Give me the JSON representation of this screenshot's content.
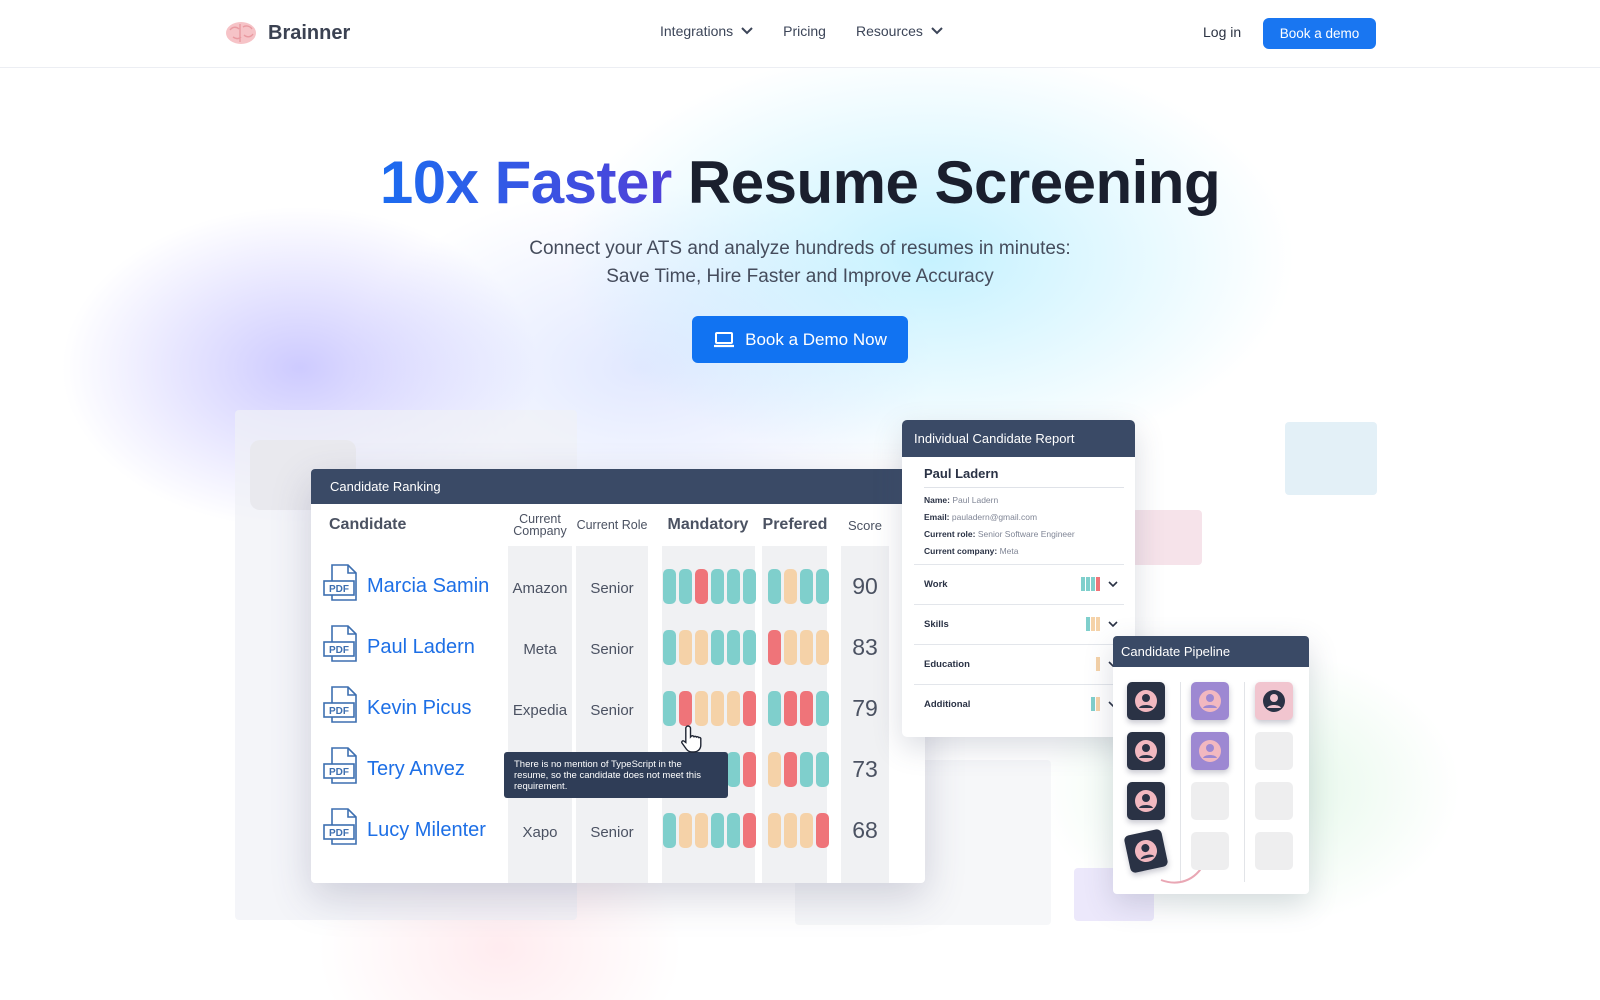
{
  "nav": {
    "brand": "Brainner",
    "links": [
      {
        "label": "Integrations",
        "dropdown": true
      },
      {
        "label": "Pricing",
        "dropdown": false
      },
      {
        "label": "Resources",
        "dropdown": true
      }
    ],
    "login": "Log in",
    "demo_button": "Book a demo"
  },
  "hero": {
    "title_accent": "10x Faster",
    "title_rest": "Resume Screening",
    "subtitle_line1": "Connect your ATS and analyze hundreds of resumes in minutes:",
    "subtitle_line2": "Save Time, Hire Faster and Improve Accuracy",
    "cta": "Book a Demo Now"
  },
  "ranking": {
    "title": "Candidate Ranking",
    "headers": {
      "candidate": "Candidate",
      "company": "Current Company",
      "role": "Current Role",
      "mandatory": "Mandatory",
      "preferred": "Prefered",
      "score": "Score"
    },
    "file_icon_label": "PDF",
    "rows": [
      {
        "name": "Marcia Samin",
        "company": "Amazon",
        "role": "Senior",
        "score": "90",
        "mandatory": [
          "teal",
          "teal",
          "red",
          "teal",
          "teal",
          "teal"
        ],
        "preferred": [
          "teal",
          "peach",
          "teal",
          "teal"
        ]
      },
      {
        "name": "Paul Ladern",
        "company": "Meta",
        "role": "Senior",
        "score": "83",
        "mandatory": [
          "teal",
          "peach",
          "peach",
          "teal",
          "teal",
          "teal"
        ],
        "preferred": [
          "red",
          "peach",
          "peach",
          "peach"
        ]
      },
      {
        "name": "Kevin Picus",
        "company": "Expedia",
        "role": "Senior",
        "score": "79",
        "mandatory": [
          "teal",
          "red",
          "peach",
          "peach",
          "peach",
          "red"
        ],
        "preferred": [
          "teal",
          "red",
          "red",
          "teal"
        ]
      },
      {
        "name": "Tery Anvez",
        "company": "",
        "role": "",
        "score": "73",
        "mandatory": [
          "teal",
          "teal",
          "peach",
          "teal",
          "teal",
          "red"
        ],
        "preferred": [
          "peach",
          "red",
          "teal",
          "teal"
        ]
      },
      {
        "name": "Lucy Milenter",
        "company": "Xapo",
        "role": "Senior",
        "score": "68",
        "mandatory": [
          "teal",
          "peach",
          "peach",
          "teal",
          "teal",
          "red"
        ],
        "preferred": [
          "peach",
          "peach",
          "peach",
          "red"
        ]
      }
    ],
    "tooltip": "There is no mention of TypeScript in the resume, so the candidate does not meet this requirement."
  },
  "report": {
    "title": "Individual Candidate Report",
    "candidate": "Paul Ladern",
    "fields": [
      {
        "label": "Name:",
        "value": "Paul Ladern"
      },
      {
        "label": "Email:",
        "value": "pauladern@gmail.com"
      },
      {
        "label": "Current role:",
        "value": "Senior Software Engineer"
      },
      {
        "label": "Current company:",
        "value": "Meta"
      }
    ],
    "sections": [
      {
        "label": "Work",
        "bars": [
          "teal",
          "teal",
          "teal",
          "red"
        ]
      },
      {
        "label": "Skills",
        "bars": [
          "teal",
          "peach",
          "peach"
        ]
      },
      {
        "label": "Education",
        "bars": [
          "peach"
        ]
      },
      {
        "label": "Additional",
        "bars": [
          "teal",
          "peach"
        ]
      }
    ]
  },
  "pipeline": {
    "title": "Candidate Pipeline"
  },
  "colors": {
    "teal": "#7fcfcc",
    "peach": "#f5d2a8",
    "red": "#ef7479",
    "brand_blue": "#1173f2",
    "card_header": "#3a4a66"
  }
}
